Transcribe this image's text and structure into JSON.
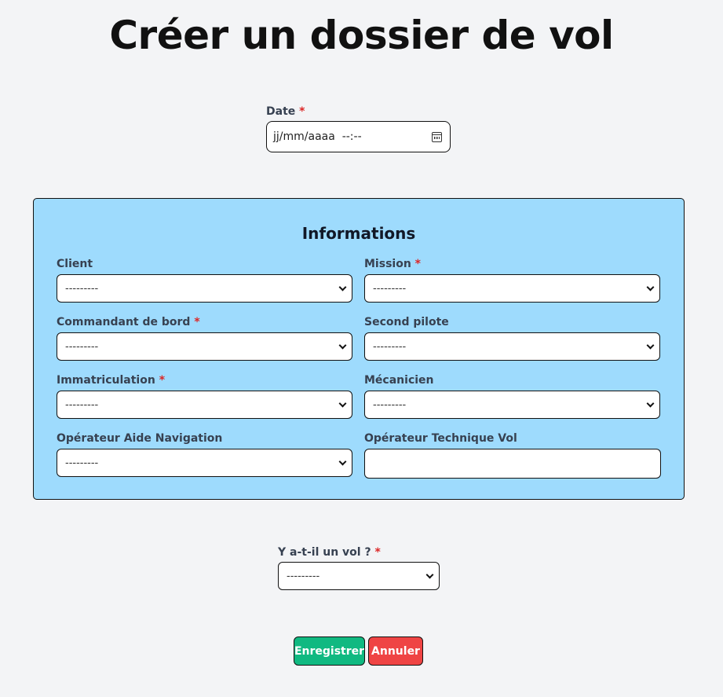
{
  "page": {
    "title": "Créer un dossier de vol"
  },
  "date": {
    "label": "Date",
    "required_mark": "*",
    "value": "jj/mm/aaaa  --:--",
    "icon": "calendar-icon"
  },
  "info": {
    "title": "Informations",
    "placeholder": "---------",
    "fields": {
      "client": {
        "label": "Client"
      },
      "mission": {
        "label": "Mission",
        "required_mark": "*"
      },
      "commandant": {
        "label": "Commandant de bord",
        "required_mark": "*"
      },
      "second_pilote": {
        "label": "Second pilote"
      },
      "immatriculation": {
        "label": "Immatriculation",
        "required_mark": "*"
      },
      "mecanicien": {
        "label": "Mécanicien"
      },
      "operateur_nav": {
        "label": "Opérateur Aide Navigation"
      },
      "operateur_tech": {
        "label": "Opérateur Technique Vol",
        "value": ""
      }
    }
  },
  "vol": {
    "label": "Y a-t-il un vol ?",
    "required_mark": "*",
    "placeholder": "---------"
  },
  "actions": {
    "save_label": "Enregistrer",
    "cancel_label": "Annuler"
  },
  "colors": {
    "background": "#f3f4f6",
    "panel": "#9edbfd",
    "save": "#10b981",
    "cancel": "#ef4444",
    "required": "#dc2626"
  }
}
